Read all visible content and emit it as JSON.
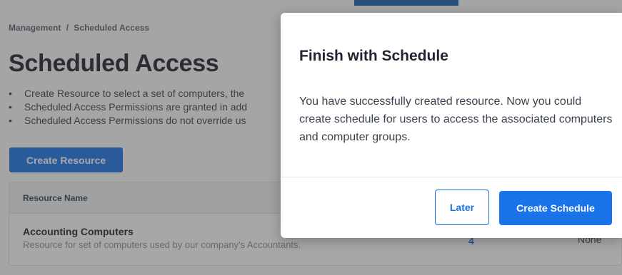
{
  "breadcrumb": {
    "parent": "Management",
    "separator": "/",
    "current": "Scheduled Access"
  },
  "page": {
    "title": "Scheduled Access",
    "bullets": [
      "Create Resource to select a set of computers, the",
      "Scheduled Access Permissions are granted in add",
      "Scheduled Access Permissions do not override us"
    ],
    "create_resource_label": "Create Resource"
  },
  "table": {
    "header_resource_name": "Resource Name",
    "rows": [
      {
        "name": "Accounting Computers",
        "description": "Resource for set of computers used by our company's Accountants.",
        "count": "4",
        "status": "None"
      }
    ]
  },
  "modal": {
    "title": "Finish with Schedule",
    "body": "You have successfully created resource. Now you could create schedule for users to access the associated computers and computer groups.",
    "later_label": "Later",
    "create_schedule_label": "Create Schedule"
  },
  "colors": {
    "primary": "#1a73e8",
    "overlay": "rgba(60,60,60,0.45)"
  }
}
